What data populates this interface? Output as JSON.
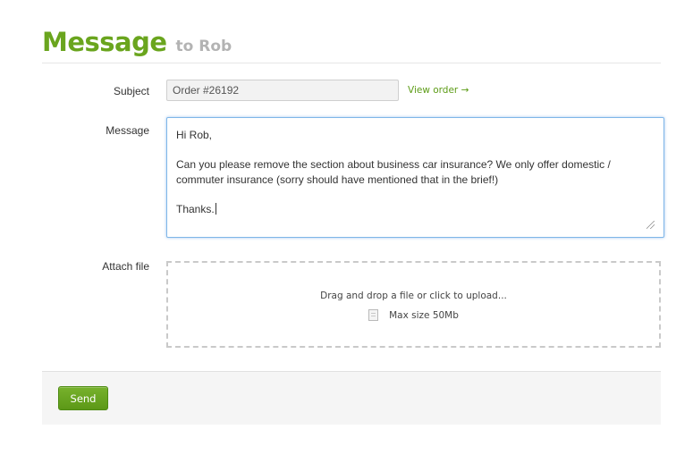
{
  "header": {
    "title": "Message",
    "subtitle": "to Rob"
  },
  "form": {
    "subject": {
      "label": "Subject",
      "value": "Order #26192",
      "link": "View order →"
    },
    "message": {
      "label": "Message",
      "lines": [
        "Hi Rob,",
        "Can you please remove the section about business car insurance? We only offer domestic /\ncommuter insurance (sorry should have mentioned that in the brief!)",
        "Thanks."
      ]
    },
    "attach": {
      "label": "Attach file",
      "drop_text": "Drag and drop a file or click to upload...",
      "limit_text": "Max size 50Mb",
      "icon": "file-icon"
    }
  },
  "footer": {
    "send_label": "Send"
  },
  "colors": {
    "accent": "#6aa51e",
    "button": "#5c9817",
    "focus": "#7fb6e8"
  }
}
